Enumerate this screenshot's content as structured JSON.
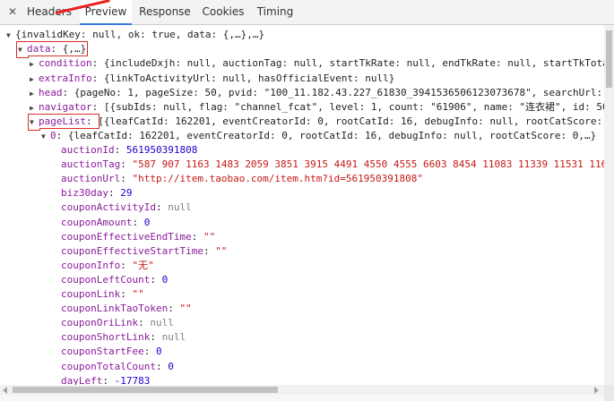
{
  "tabs": {
    "close": "✕",
    "headers": "Headers",
    "preview": "Preview",
    "response": "Response",
    "cookies": "Cookies",
    "timing": "Timing"
  },
  "tree": {
    "root": "{invalidKey: null, ok: true, data: {,…},…}",
    "data_key": "data",
    "data_preview": "{,…}",
    "condition_key": "condition",
    "condition_val": "{includeDxjh: null, auctionTag: null, startTkRate: null, endTkRate: null, startTkTota",
    "extraInfo_key": "extraInfo",
    "extraInfo_val": "{linkToActivityUrl: null, hasOfficialEvent: null}",
    "head_key": "head",
    "head_val": "{pageNo: 1, pageSize: 50, pvid: \"100_11.182.43.227_61830_3941536506123073678\", searchUrl: ",
    "navigator_key": "navigator",
    "navigator_val": "[{subIds: null, flag: \"channel_fcat\", level: 1, count: \"61906\", name: \"连衣裙\", id: 50",
    "pageList_key": "pageList",
    "pageList_val": "[{leafCatId: 162201, eventCreatorId: 0, rootCatId: 16, debugInfo: null, rootCatScore:",
    "item0_key": "0",
    "item0_val": "{leafCatId: 162201, eventCreatorId: 0, rootCatId: 16, debugInfo: null, rootCatScore: 0,…}",
    "fields": [
      {
        "key": "auctionId",
        "value": "561950391808",
        "type": "num"
      },
      {
        "key": "auctionTag",
        "value": "\"587 907 1163 1483 2059 3851 3915 4491 4550 4555 6603 8454 11083 11339 11531 116",
        "type": "str"
      },
      {
        "key": "auctionUrl",
        "value": "\"http://item.taobao.com/item.htm?id=561950391808\"",
        "type": "str"
      },
      {
        "key": "biz30day",
        "value": "29",
        "type": "num"
      },
      {
        "key": "couponActivityId",
        "value": "null",
        "type": "null"
      },
      {
        "key": "couponAmount",
        "value": "0",
        "type": "num"
      },
      {
        "key": "couponEffectiveEndTime",
        "value": "\"\"",
        "type": "str"
      },
      {
        "key": "couponEffectiveStartTime",
        "value": "\"\"",
        "type": "str"
      },
      {
        "key": "couponInfo",
        "value": "\"无\"",
        "type": "str"
      },
      {
        "key": "couponLeftCount",
        "value": "0",
        "type": "num"
      },
      {
        "key": "couponLink",
        "value": "\"\"",
        "type": "str"
      },
      {
        "key": "couponLinkTaoToken",
        "value": "\"\"",
        "type": "str"
      },
      {
        "key": "couponOriLink",
        "value": "null",
        "type": "null"
      },
      {
        "key": "couponShortLink",
        "value": "null",
        "type": "null"
      },
      {
        "key": "couponStartFee",
        "value": "0",
        "type": "num"
      },
      {
        "key": "couponTotalCount",
        "value": "0",
        "type": "num"
      },
      {
        "key": "dayLeft",
        "value": "-17783",
        "type": "num"
      }
    ]
  },
  "colors": {
    "key": "#8a1b9b",
    "string": "#c41a16",
    "number": "#1c00cf",
    "null": "#808080",
    "annotation": "#e8221d",
    "tab_active": "#3879d9"
  }
}
